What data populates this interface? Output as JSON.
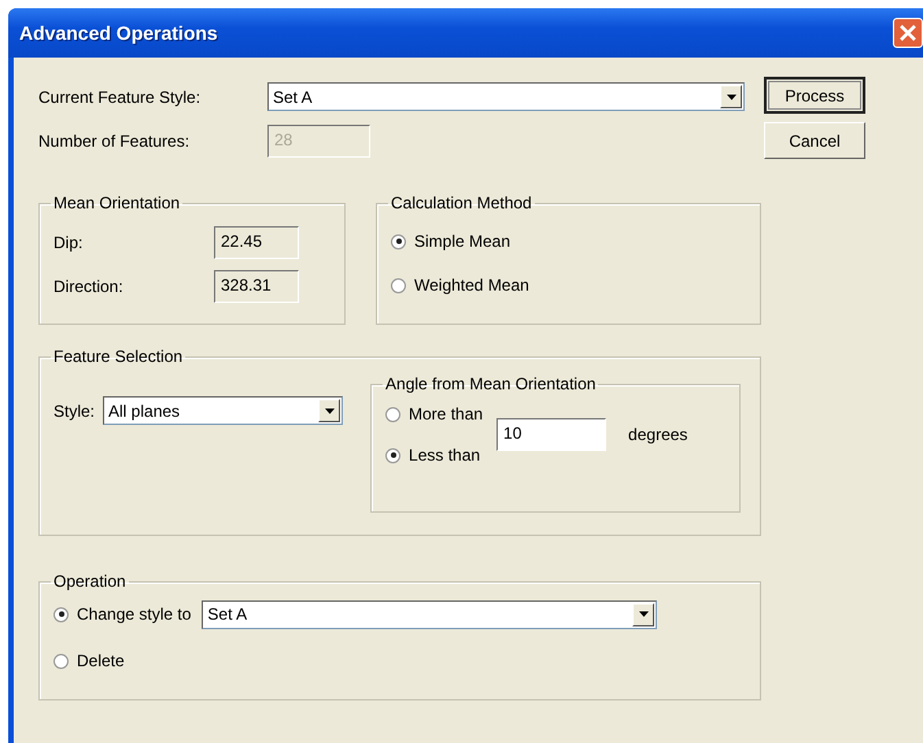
{
  "window": {
    "title": "Advanced Operations"
  },
  "current_feature_style": {
    "label": "Current Feature Style:",
    "value": "Set A"
  },
  "number_of_features": {
    "label": "Number of Features:",
    "value": "28",
    "disabled": true
  },
  "buttons": [
    {
      "label": "Process",
      "default": true
    },
    {
      "label": "Cancel",
      "default": false
    }
  ],
  "mean_orientation": {
    "title": "Mean Orientation",
    "fields": [
      {
        "label": "Dip:",
        "value": "22.45"
      },
      {
        "label": "Direction:",
        "value": "328.31"
      }
    ]
  },
  "calculation_method": {
    "title": "Calculation Method",
    "options": [
      {
        "label": "Simple Mean",
        "selected": true
      },
      {
        "label": "Weighted Mean",
        "selected": false
      }
    ]
  },
  "feature_selection": {
    "title": "Feature Selection",
    "style": {
      "label": "Style:",
      "value": "All planes"
    },
    "angle": {
      "title": "Angle from Mean Orientation",
      "options": [
        {
          "label": "More than",
          "selected": false
        },
        {
          "label": "Less than",
          "selected": true
        }
      ],
      "value": "10",
      "unit": "degrees"
    }
  },
  "operation": {
    "title": "Operation",
    "options": [
      {
        "label": "Change style to",
        "selected": true
      },
      {
        "label": "Delete",
        "selected": false
      }
    ],
    "style_value": "Set A"
  }
}
